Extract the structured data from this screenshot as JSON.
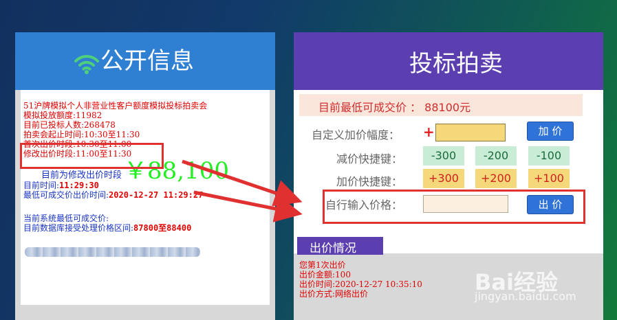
{
  "public_info": {
    "title": "公开信息",
    "lines": [
      "51沪牌模拟个人非营业性客户额度模拟投标拍卖会",
      "模拟投放额度:11982",
      "目前已投标人数:268478",
      "拍卖会起止时间:10:30至11:30",
      "首次出价时段:10:30至11:00",
      "修改出价时段:11:00至11:30"
    ],
    "current_phase": "目前为修改出价时段",
    "current_time_label": "目前时间:",
    "current_time": "11:29:30",
    "min_price_time_label": "最低可成交价出价时间:",
    "min_price_time": "2020-12-27 11:29:27",
    "system_min_price_label": "当前系统最低可成交价:",
    "system_min_price": "￥88,100",
    "db_range_label": "目前数据库接受处理价格区间:",
    "db_range": "87800至88400"
  },
  "auction": {
    "title": "投标拍卖",
    "min_price_text": "目前最低可成交价 ： 88100元",
    "custom_increment_label": "自定义加价幅度：",
    "plus_sign": "+",
    "add_button": "加 价",
    "decrease_label": "减价快捷键：",
    "decrease_keys": [
      "-300",
      "-200",
      "-100"
    ],
    "increase_label": "加价快捷键：",
    "increase_keys": [
      "+300",
      "+200",
      "+100"
    ],
    "self_input_label": "自行输入价格：",
    "bid_button": "出 价"
  },
  "bid_status": {
    "header": "出价情况",
    "lines": [
      "您第1次出价",
      "出价金额:100",
      "出价时间:2020-12-27 10:35:10",
      "出价方式:网络出价"
    ]
  },
  "watermark": {
    "brand": "Bai经验",
    "url": "jingyan.baidu.com"
  },
  "colors": {
    "left_header": "#2f7fd3",
    "right_header": "#5b3fb0",
    "highlight_red": "#e03030",
    "price_green": "#22ee22"
  }
}
